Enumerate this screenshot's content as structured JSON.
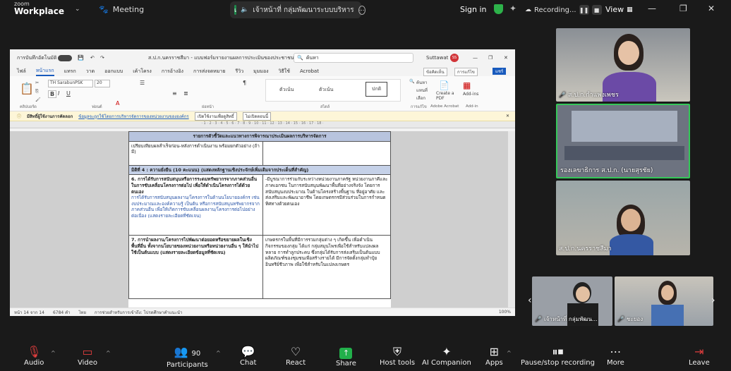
{
  "topbar": {
    "logo_top": "zoom",
    "logo_bottom": "Workplace",
    "meeting_label": "Meeting",
    "active_speaker_initial": "เ",
    "active_speaker": "เจ้าหน้าที่ กลุ่มพัฒนาระบบบริหาร",
    "sign_in": "Sign in",
    "recording": "Recording...",
    "view": "View"
  },
  "word": {
    "autosave": "การบันทึกอัตโนมัติ",
    "doc_title": "ส.ป.ก.นครราชสีมา - แบบฟอร์มรายงานผลการประเมินของประชาชนต่อการดําเนินงาน • บันทึกแล้ว",
    "search_placeholder": "ค้นหา",
    "user": "Suttawat S.",
    "user_initials": "SS",
    "tabs": [
      "ไฟล์",
      "หน้าแรก",
      "แทรก",
      "วาด",
      "ออกแบบ",
      "เค้าโครง",
      "การอ้างอิง",
      "การส่งจดหมาย",
      "รีวิว",
      "มุมมอง",
      "วิธีใช้",
      "Acrobat"
    ],
    "font_name": "TH SarabunPSK",
    "font_size": "20",
    "styles": [
      "ตัวเน้น",
      "ตัวเน้น",
      "ปกติ"
    ],
    "ribbon_groups": [
      "คลิปบอร์ด",
      "ฟอนต์",
      "ย่อหน้า",
      "สไตล์",
      "การแก้ไข",
      "Adobe Acrobat",
      "Add-in"
    ],
    "ribbon_right": [
      "ข้อคิดเห็น",
      "การแก้ไข",
      "แชร์"
    ],
    "editing_items": [
      "ค้นหา",
      "แทนที่",
      "เลือก"
    ],
    "acrobat_label": "Create a PDF",
    "addins_label": "Add-ins",
    "infobar_title": "มีสิทธิ์ผู้ใช้งานการคัดลอก",
    "infobar_text": "ข้อมูลจะถูกใช้โดยการบริหารจัดการของหน่วยงานขององค์กร",
    "infobar_btn1": "เปิดใช้งานเพื่อดูสิทธิ์",
    "infobar_btn2": "ไม่เปิดตอนนี้",
    "doc": {
      "top_header": "รายการตัวชี้วัดและแนวทางการพิจารณาประเมินผลการบริหารจัดการ",
      "row0": "เปรียบเทียบผลสำเร็จก่อน-หลังการดำเนินงาน พร้อมยกตัวอย่าง (ถ้ามี)",
      "section": "มิติที่ 4 : ความยั่งยืน (10 คะแนน) (แสดงหลักฐานเชิงประจักษ์เพิ่มเติมจากประเด็นที่สำคัญ)",
      "q6_title": "6. การได้รับการสนับสนุนหรือการระดมทรัพยากรจากภาคส่วนอื่นในการขับเคลื่อนโครงการต่อไป เพื่อให้ดำเนินโครงการได้ด้วยตนเอง",
      "q6_desc": "การได้รับการสนับสนุนผลงาน/โครงการในด้านนโยบายองค์กร เช่น งบประมาณและองค์ความรู้ เป็นต้น หรือการสนับสนุนทรัพยากรจากภาคส่วนอื่น เพื่อให้เกิดการขับเคลื่อนผลงาน/โครงการต่อไปอย่างต่อเนื่อง (แสดงรายละเอียดที่ชัดเจน)",
      "q6_answer": "-มีบูรณาการร่วมกับระหว่างหน่วยงานภาครัฐ หน่วยงานภาคีและภาคเอกชน ในการสนับสนุนพัฒนาพื้นที่อย่างจริงจัง โดยการสนับสนุนงบประมาณ ในด้านโครงสร้างพื้นฐาน ที่อยู่อาศัย และส่งเสริมและพัฒนาอาชีพ โดยเกษตรกรมีส่วนร่วมในการกำหนดทิศทางด้วยตนเอง",
      "q7_title": "7. การนำผลงาน/โครงการไปพัฒนาต่อยอดหรือขยายผลในเชิงพื้นที่อื่น ทั้งจากนโยบายของหน่วยงานหรือหน่วยงานอื่น ๆ ให้นำไปใช้เป็นต้นแบบ (แสดงรายละเอียดข้อมูลที่ชัดเจน)",
      "q7_answer": "เกษตรกรในพื้นที่มีการรวมกลุ่มต่าง ๆ เกิดขึ้น เพื่อดำเนินกิจกรรมของกลุ่ม ได้แก่ กลุ่มสมุนไพรเพื่อใช้สำหรับแปลงผลหลาย การทำลูกประคบ ซึ่งกลุ่มได้รับการส่งเสริมเป็นต้นแบบ ผลิตภัณฑ์ของชุมชนเพื่อสร้างรายได้ มีการจัดตั้งกลุ่มทำปุ๋ยอินทรีย์ชีวภาพ เพื่อใช้สำหรับในแปลงเกษตร"
    },
    "status": [
      "หน้า 14 จาก 14",
      "6784 คำ",
      "ไทย",
      "การช่วยสำหรับการเข้าถึง: โปรดศึกษาคำแนะนำ"
    ],
    "zoom": "100%"
  },
  "participants": [
    {
      "name": "ส.ป.ก.กำแพงเพชร"
    },
    {
      "name": "รองเลขาธิการ ส.ป.ก. (นายสุรชัย)"
    },
    {
      "name": "ส.ป.ก.นครราชสีมา"
    },
    {
      "name": "เจ้าหน้าที่ กลุ่มพัฒน..."
    },
    {
      "name": "ชะยอง"
    }
  ],
  "toolbar": {
    "audio": "Audio",
    "video": "Video",
    "participants": "Participants",
    "participants_count": "90",
    "chat": "Chat",
    "react": "React",
    "share": "Share",
    "host_tools": "Host tools",
    "ai": "AI Companion",
    "apps": "Apps",
    "pause_rec": "Pause/stop recording",
    "more": "More",
    "leave": "Leave"
  },
  "colors": {
    "accent": "#185abd",
    "share_green": "#22b04b",
    "leave_red": "#e03d3d",
    "speaker_border": "#35c759"
  }
}
